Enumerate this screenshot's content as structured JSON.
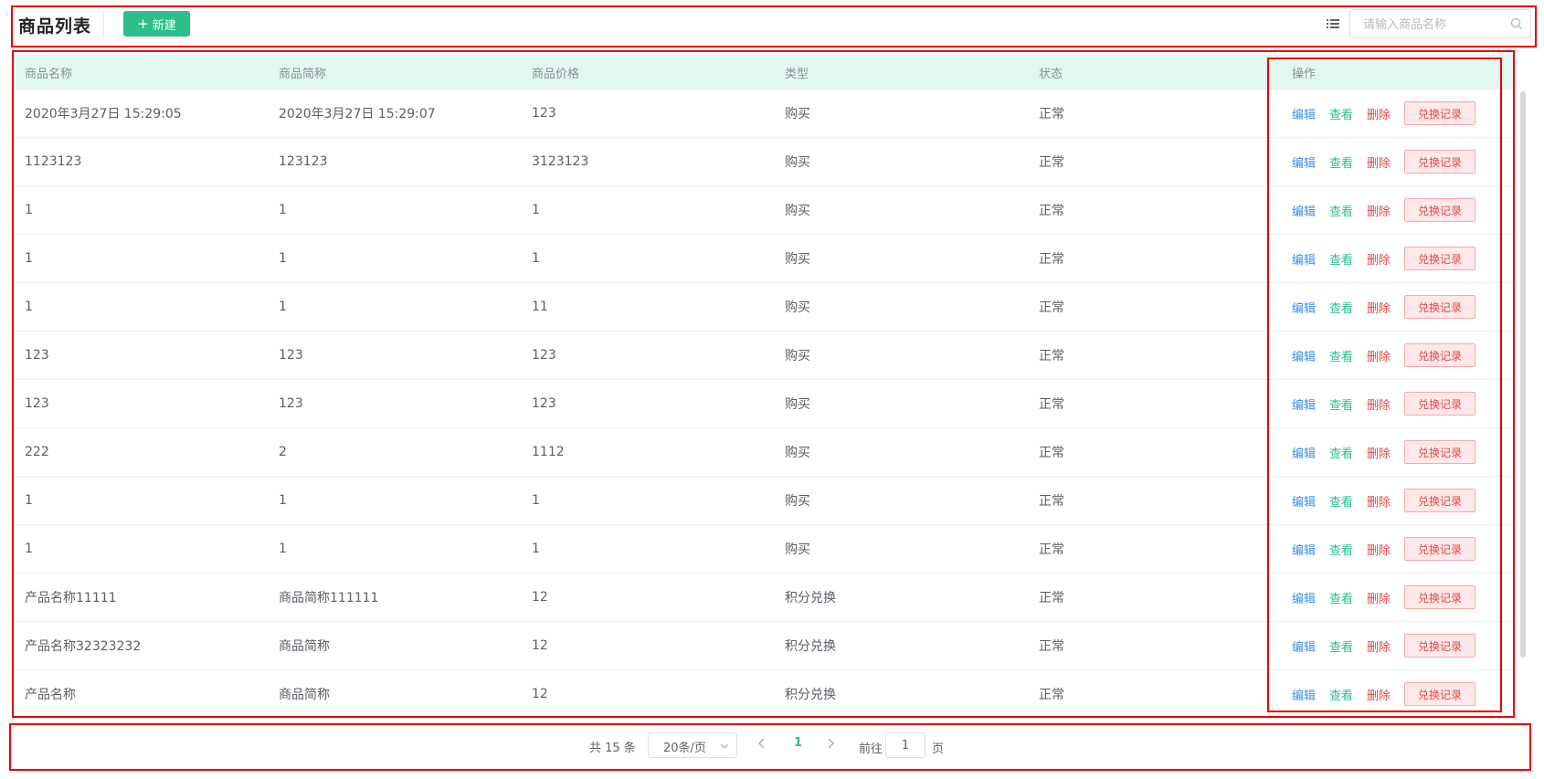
{
  "header": {
    "title": "商品列表",
    "new_button_label": "新建",
    "search_placeholder": "请输入商品名称",
    "search_value": ""
  },
  "table": {
    "columns": [
      "商品名称",
      "商品简称",
      "商品价格",
      "类型",
      "状态",
      "操作"
    ],
    "actions": {
      "edit": "编辑",
      "view": "查看",
      "delete": "删除",
      "records": "兑换记录"
    },
    "rows": [
      [
        "2020年3月27日 15:29:05",
        "2020年3月27日 15:29:07",
        "123",
        "购买",
        "正常"
      ],
      [
        "1123123",
        "123123",
        "3123123",
        "购买",
        "正常"
      ],
      [
        "1",
        "1",
        "1",
        "购买",
        "正常"
      ],
      [
        "1",
        "1",
        "1",
        "购买",
        "正常"
      ],
      [
        "1",
        "1",
        "11",
        "购买",
        "正常"
      ],
      [
        "123",
        "123",
        "123",
        "购买",
        "正常"
      ],
      [
        "123",
        "123",
        "123",
        "购买",
        "正常"
      ],
      [
        "222",
        "2",
        "1112",
        "购买",
        "正常"
      ],
      [
        "1",
        "1",
        "1",
        "购买",
        "正常"
      ],
      [
        "1",
        "1",
        "1",
        "购买",
        "正常"
      ],
      [
        "产品名称11111",
        "商品简称111111",
        "12",
        "积分兑换",
        "正常"
      ],
      [
        "产品名称32323232",
        "商品简称",
        "12",
        "积分兑换",
        "正常"
      ],
      [
        "产品名称",
        "商品简称",
        "12",
        "积分兑换",
        "正常"
      ]
    ]
  },
  "pagination": {
    "total_text": "共 15 条",
    "page_size": "20条/页",
    "current_page": "1",
    "goto_label": "前往",
    "goto_value": "1",
    "page_unit": "页"
  },
  "colors": {
    "accent": "#2bbf8a",
    "edit": "#3a8ee6",
    "delete": "#e84545",
    "header_bg": "#e3f6ef",
    "annotation": "#e8000b"
  }
}
